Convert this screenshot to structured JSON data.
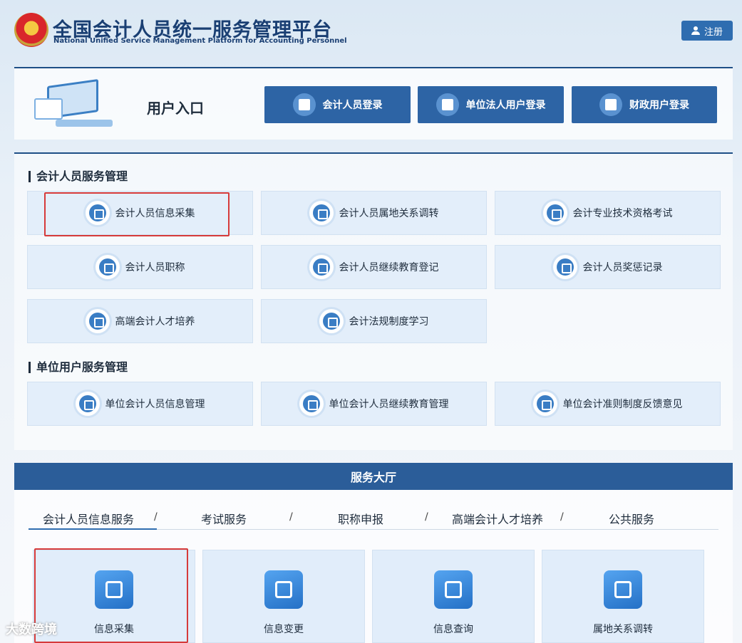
{
  "header": {
    "title_cn": "全国会计人员统一服务管理平台",
    "title_en": "National Unified Service Management Platform for Accounting Personnel",
    "register_label": "注册"
  },
  "entry": {
    "title": "用户入口",
    "buttons": [
      {
        "label": "会计人员登录",
        "icon": "user-icon"
      },
      {
        "label": "单位法人用户登录",
        "icon": "building-icon"
      },
      {
        "label": "财政用户登录",
        "icon": "id-card-icon"
      }
    ]
  },
  "services": {
    "accountant_title": "会计人员服务管理",
    "accountant_items": [
      {
        "label": "会计人员信息采集",
        "icon": "form-edit-icon",
        "highlighted": true
      },
      {
        "label": "会计人员属地关系调转",
        "icon": "location-user-icon"
      },
      {
        "label": "会计专业技术资格考试",
        "icon": "exam-icon"
      },
      {
        "label": "会计人员职称",
        "icon": "title-doc-icon"
      },
      {
        "label": "会计人员继续教育登记",
        "icon": "education-search-icon"
      },
      {
        "label": "会计人员奖惩记录",
        "icon": "award-icon"
      },
      {
        "label": "高端会计人才培养",
        "icon": "graduation-cap-icon"
      },
      {
        "label": "会计法规制度学习",
        "icon": "video-play-icon"
      }
    ],
    "unit_title": "单位用户服务管理",
    "unit_items": [
      {
        "label": "单位会计人员信息管理",
        "icon": "info-box-icon"
      },
      {
        "label": "单位会计人员继续教育管理",
        "icon": "education-search-icon"
      },
      {
        "label": "单位会计准则制度反馈意见",
        "icon": "feedback-icon"
      }
    ]
  },
  "hall": {
    "title": "服务大厅",
    "tabs": [
      "会计人员信息服务",
      "考试服务",
      "职称申报",
      "高端会计人才培养",
      "公共服务"
    ],
    "separator": "/",
    "active_tab": 0,
    "cards": [
      {
        "label": "信息采集",
        "icon": "form-edit-icon",
        "highlighted": true
      },
      {
        "label": "信息变更",
        "icon": "swap-icon"
      },
      {
        "label": "信息查询",
        "icon": "drawer-icon"
      },
      {
        "label": "属地关系调转",
        "icon": "location-user-icon"
      }
    ]
  },
  "watermark": "大数跨境"
}
